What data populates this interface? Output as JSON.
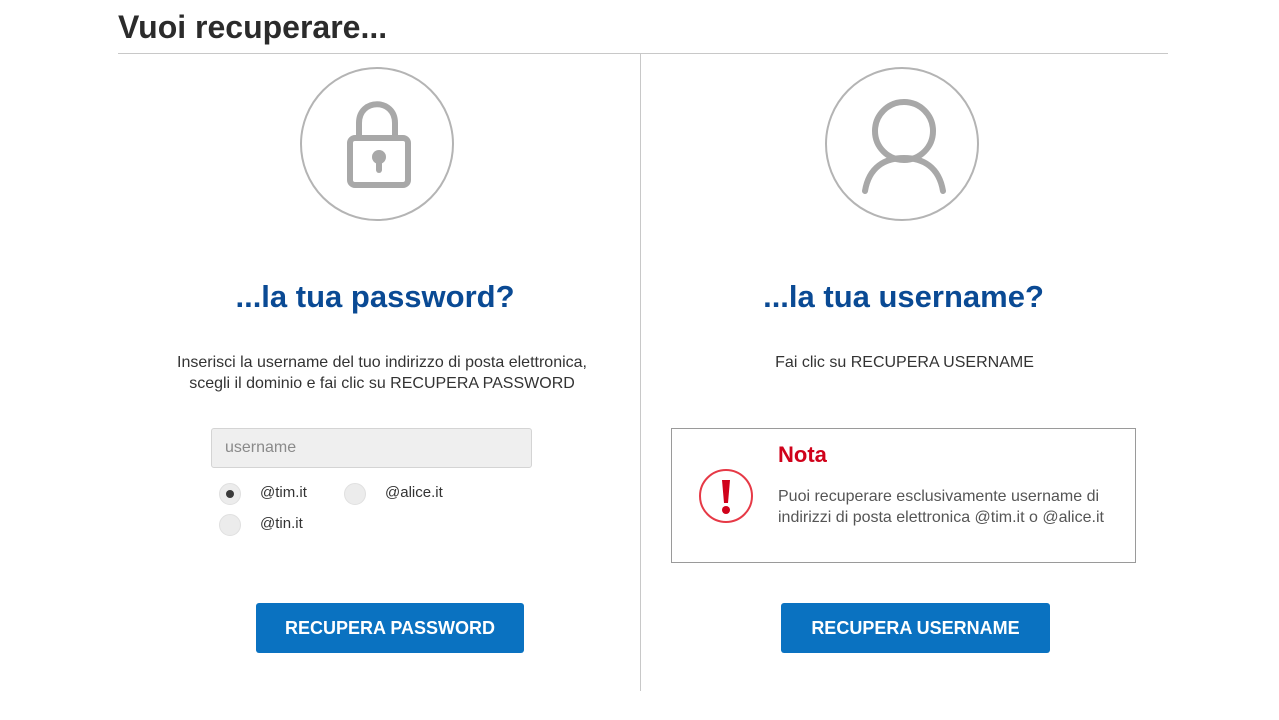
{
  "page": {
    "title": "Vuoi recuperare..."
  },
  "password_section": {
    "icon": "lock-icon",
    "heading": "...la tua password?",
    "description_line1": "Inserisci la username del tuo indirizzo di posta elettronica,",
    "description_line2": "scegli il dominio e fai clic su RECUPERA PASSWORD",
    "username_placeholder": "username",
    "username_value": "",
    "domain_options": [
      {
        "label": "@tim.it",
        "selected": true
      },
      {
        "label": "@alice.it",
        "selected": false
      },
      {
        "label": "@tin.it",
        "selected": false
      }
    ],
    "button_label": "RECUPERA PASSWORD"
  },
  "username_section": {
    "icon": "user-icon",
    "heading": "...la tua username?",
    "description": "Fai clic su RECUPERA USERNAME",
    "note": {
      "icon": "exclamation-icon",
      "title": "Nota",
      "text": "Puoi recuperare esclusivamente username di indirizzi di posta elettronica @tim.it o @alice.it"
    },
    "button_label": "RECUPERA USERNAME"
  },
  "colors": {
    "heading_blue": "#0a4a94",
    "button_blue": "#0a72c1",
    "note_red": "#d0021b",
    "icon_gray": "#b4b4b4"
  }
}
